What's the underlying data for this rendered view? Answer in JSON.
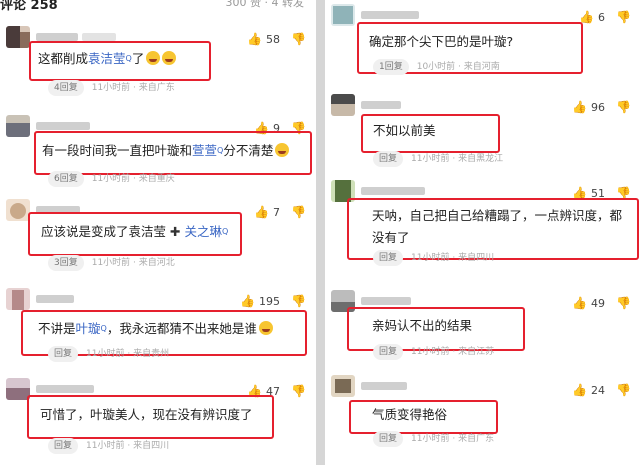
{
  "left": {
    "header": {
      "title": "评论 258",
      "meta": "300 赞 · 4 转发"
    },
    "comments": [
      {
        "avatar": [
          "#4a3b3a",
          "#d8c6b8"
        ],
        "content_parts": [
          "这都削成",
          "袁洁莹",
          "了"
        ],
        "emoji": 2,
        "likes": "58",
        "replies": "4回复",
        "time": "11小时前",
        "location": "来自广东"
      },
      {
        "avatar": [
          "#6d6f7b",
          "#c9c2b6"
        ],
        "content_parts": [
          "有一段时间我一直把叶璇和",
          "萱萱",
          "分不清楚"
        ],
        "emoji": 1,
        "likes": "9",
        "replies": "6回复",
        "time": "11小时前",
        "location": "来自重庆"
      },
      {
        "avatar": [
          "#c9a98a",
          "#f0e0d0"
        ],
        "content_parts": [
          "应该说是变成了袁洁莹",
          "关之琳"
        ],
        "plus": "✚",
        "likes": "7",
        "replies": "3回复",
        "time": "11小时前",
        "location": "来自河北"
      },
      {
        "avatar": [
          "#b58a8a",
          "#e7d2d2"
        ],
        "content_parts": [
          "不讲是",
          "叶璇",
          "，我永远都猜不出来她是谁"
        ],
        "emoji": 1,
        "likes": "195",
        "replies": "回复",
        "time": "11小时前",
        "location": "来自贵州"
      },
      {
        "avatar": [
          "#8e6f7d",
          "#d7c6cf"
        ],
        "content_parts": [
          "可惜了，叶璇美人，现在没有辨识度了"
        ],
        "likes": "47",
        "replies": "回复",
        "time": "11小时前",
        "location": "来自四川"
      }
    ]
  },
  "right": {
    "comments": [
      {
        "avatar": [
          "#8fb3b8",
          "#dce8ea"
        ],
        "content": "确定那个尖下巴的是叶璇?",
        "likes": "6",
        "replies": "1回复",
        "time": "10小时前",
        "location": "来自河南"
      },
      {
        "avatar": [
          "#4b4b4b",
          "#c7b9a8"
        ],
        "content": "不如以前美",
        "likes": "96",
        "replies": "回复",
        "time": "11小时前",
        "location": "来自黑龙江"
      },
      {
        "avatar": [
          "#55703d",
          "#cfe0b8"
        ],
        "content": "天呐，自己把自己给糟蹋了，一点辨识度，都没有了",
        "likes": "51",
        "replies": "回复",
        "time": "11小时前",
        "location": "来自四川"
      },
      {
        "avatar": [
          "#6d6d6d",
          "#bcbcbc"
        ],
        "content": "亲妈认不出的结果",
        "likes": "49",
        "replies": "回复",
        "time": "11小时前",
        "location": "来自江苏"
      },
      {
        "avatar": [
          "#7a6a55",
          "#e2d6c3"
        ],
        "content": "气质变得艳俗",
        "likes": "24",
        "replies": "回复",
        "time": "11小时前",
        "location": "来自广东"
      }
    ]
  },
  "icons": {
    "like": "thumbs-up-icon",
    "dislike": "thumbs-down-icon",
    "highlight": "#e5202e",
    "link": "#3a66c4"
  }
}
